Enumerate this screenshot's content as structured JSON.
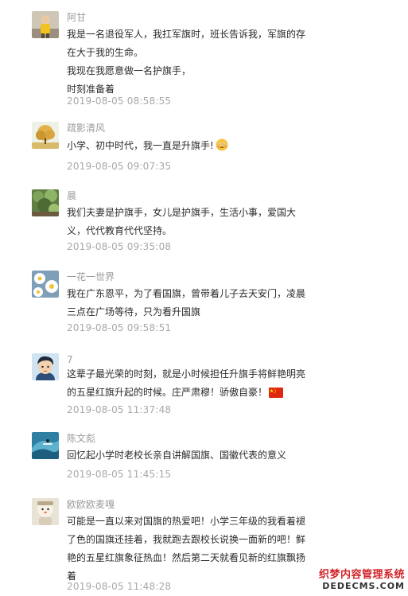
{
  "comments": [
    {
      "name": "阿甘",
      "lines": [
        "我是一名退役军人，我扛军旗时，班长告诉我，军旗的存",
        "在大于我的生命。",
        "我现在我愿意做一名护旗手，",
        "时刻准备着"
      ],
      "time": "2019-08-05 08:58:55",
      "avatar_icon": "child-photo-avatar"
    },
    {
      "name": "疏影清风",
      "lines": [
        "小学、初中时代，我一直是升旗手!"
      ],
      "time": "2019-08-05 09:07:35",
      "avatar_icon": "golden-tree-avatar",
      "emoji": "embarrassed-face-emoji"
    },
    {
      "name": "晨",
      "lines": [
        "我们夫妻是护旗手，女儿是护旗手，生活小事，爱国大",
        "义，代代教育代代坚持。"
      ],
      "time": "2019-08-05 09:35:08",
      "avatar_icon": "green-plants-avatar"
    },
    {
      "name": "一花一世界",
      "lines": [
        "我在广东恩平，为了看国旗，曾带着儿子去天安门，凌晨",
        "三点在广场等待，只为看升国旗"
      ],
      "time": "2019-08-05 09:58:51",
      "avatar_icon": "daisy-flowers-avatar"
    },
    {
      "name": "7",
      "lines": [
        "这辈子最光荣的时刻，就是小时候担任升旗手将鲜艳明亮",
        "的五星红旗升起的时候。庄严肃穆！骄傲自豪！"
      ],
      "time": "2019-08-05 11:37:48",
      "avatar_icon": "cartoon-boy-avatar",
      "emoji": "china-flag-emoji"
    },
    {
      "name": "陈文彪",
      "lines": [
        "回忆起小学时老校长亲自讲解国旗、国徽代表的意义"
      ],
      "time": "2019-08-05 11:45:15",
      "avatar_icon": "surfing-wave-avatar"
    },
    {
      "name": "欧欧欧麦嘎",
      "lines": [
        "可能是一直以来对国旗的热爱吧！小学三年级的我看着褪",
        "了色的国旗还挂着，我就跑去跟校长说换一面新的吧！鲜",
        "艳的五星红旗象征热血！然后第二天就看见新的红旗飘扬",
        "着"
      ],
      "time": "2019-08-05 11:48:28",
      "avatar_icon": "snowman-toy-avatar"
    }
  ],
  "watermark": {
    "line1": "织梦内容管理系统",
    "line2": "DEDECMS.COM"
  },
  "colors": {
    "name": "#9a9a9a",
    "content": "#2b2b2b",
    "time": "#a8a8a8",
    "watermark_red": "#d2232a"
  }
}
